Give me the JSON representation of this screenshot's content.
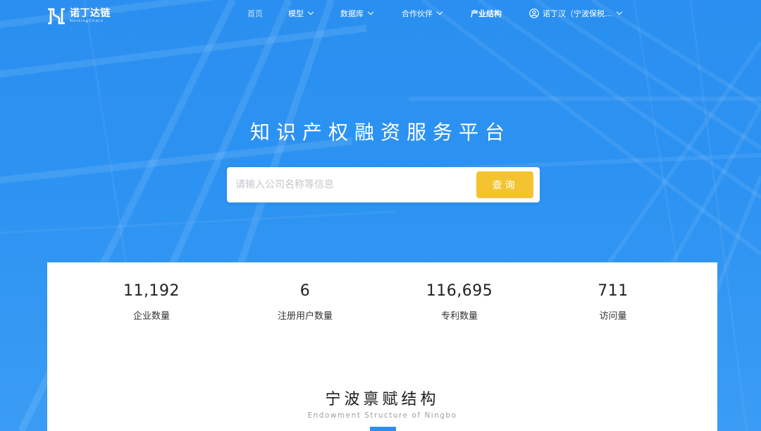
{
  "colors": {
    "hero_blue": "#2d93f2",
    "button_yellow": "#f3c430",
    "accent_blue": "#2d8df0"
  },
  "brand": {
    "name_cn": "诺丁达链",
    "name_en": "NottingChain"
  },
  "nav": {
    "items": [
      {
        "label": "首页",
        "has_dropdown": false
      },
      {
        "label": "模型",
        "has_dropdown": true
      },
      {
        "label": "数据库",
        "has_dropdown": true
      },
      {
        "label": "合作伙伴",
        "has_dropdown": true
      },
      {
        "label": "产业结构",
        "has_dropdown": false
      }
    ],
    "user": {
      "label": "诺丁汉（宁波保税...",
      "icon": "user-circle-icon"
    }
  },
  "hero": {
    "title": "知识产权融资服务平台",
    "search": {
      "placeholder": "请输入公司名称等信息",
      "value": "",
      "button_label": "查询"
    }
  },
  "stats": [
    {
      "value": "11,192",
      "label": "企业数量"
    },
    {
      "value": "6",
      "label": "注册用户数量"
    },
    {
      "value": "116,695",
      "label": "专利数量"
    },
    {
      "value": "711",
      "label": "访问量"
    }
  ],
  "section": {
    "title": "宁波禀赋结构",
    "subtitle": "Endowment Structure of Ningbo"
  }
}
